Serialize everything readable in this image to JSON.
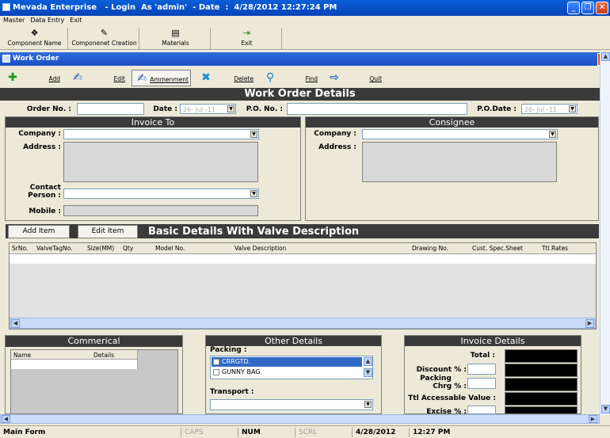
{
  "window": {
    "title": "Mevada Enterprise   - Login  As 'admin'  - Date  :  4/28/2012 12:27:24 PM"
  },
  "menu": [
    "Master",
    "Data Entry",
    "Exit"
  ],
  "main_toolbar": [
    {
      "label": "Component Name",
      "icon": "component-icon"
    },
    {
      "label": "Componenet Creation",
      "icon": "creation-icon"
    },
    {
      "label": "Materials",
      "icon": "materials-icon"
    },
    {
      "label": "Exit",
      "icon": "exit-icon"
    }
  ],
  "child_window": {
    "title": "Work Order"
  },
  "form_toolbar": {
    "add": "Add",
    "edit": "Edit",
    "ammenment": "Ammenment",
    "delete": "Delete",
    "find": "Find",
    "quit": "Quit"
  },
  "header_title": "Work Order Details",
  "order": {
    "order_no_label": "Order No. :",
    "date_label": "Date :",
    "date_value": "26- Jul -11",
    "po_no_label": "P.O. No. :",
    "po_date_label": "P.O.Date :",
    "po_date_value": "26- Jul -11"
  },
  "invoice_to": {
    "title": "Invoice To",
    "company_label": "Company :",
    "address_label": "Address :",
    "contact_label_1": "Contact",
    "contact_label_2": "Person :",
    "mobile_label": "Mobile :"
  },
  "consignee": {
    "title": "Consignee",
    "company_label": "Company :",
    "address_label": "Address :"
  },
  "items": {
    "add_button": "Add Item",
    "edit_button": "Edit Item",
    "title": "Basic Details With Valve Description",
    "columns": [
      "SrNo.",
      "ValveTagNo.",
      "Size(MM)",
      "Qty",
      "Model No.",
      "Valve Description",
      "Drawing No.",
      "Cust. Spec.Sheet",
      "Ttl.Rates"
    ]
  },
  "commercial": {
    "title": "Commerical",
    "columns": [
      "Name",
      "Details"
    ]
  },
  "other_details": {
    "title": "Other Details",
    "packing_label": "Packing :",
    "packing_options": [
      "CRRGTD.",
      "GUNNY BAG"
    ],
    "transport_label": "Transport :"
  },
  "invoice_details": {
    "title": "Invoice Details",
    "total_label": "Total :",
    "discount_label": "Discount % :",
    "packing_label_1": "Packing",
    "packing_label_2": "Chrg % :",
    "ttl_accessable_label": "Ttl Accessable Value :",
    "excise_label": "Excise % :"
  },
  "statusbar": {
    "form": "Main Form",
    "caps": "CAPS",
    "num": "NUM",
    "scrl": "SCRL",
    "date": "4/28/2012",
    "time": "12:27 PM"
  },
  "colors": {
    "titlebar": "#0a5fd8",
    "section_header": "#3a3a3a",
    "selected_option": "#316ac5"
  }
}
